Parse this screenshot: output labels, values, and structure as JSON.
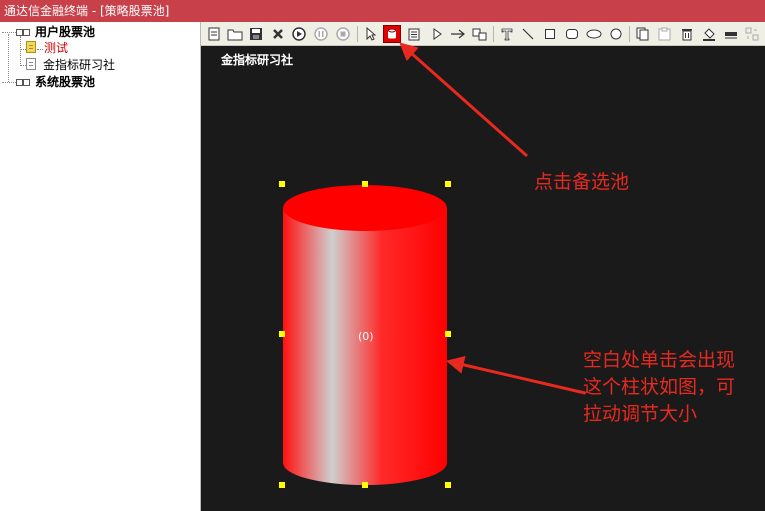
{
  "window": {
    "title": "通达信金融终端 - [策略股票池]"
  },
  "tree": {
    "items": [
      {
        "label": "用户股票池",
        "style": "bold"
      },
      {
        "label": "测试",
        "style": "red"
      },
      {
        "label": "金指标研习社",
        "style": "normal"
      },
      {
        "label": "系统股票池",
        "style": "bold"
      }
    ]
  },
  "toolbar": {
    "buttons": [
      "new-doc-icon",
      "open-folder-icon",
      "save-icon",
      "delete-icon",
      "play-icon",
      "pause-icon",
      "stop-icon",
      "select-arrow-icon",
      "stock-pool-icon",
      "list-icon",
      "triangle-icon",
      "arrow-icon",
      "link-icon",
      "text-icon",
      "line-icon",
      "rectangle-icon",
      "rounded-rect-icon",
      "ellipse-icon",
      "circle-icon",
      "copy-icon",
      "paste-icon",
      "trash-icon",
      "fill-icon",
      "line-width-icon",
      "align-icon"
    ],
    "active": "stock-pool-icon"
  },
  "canvas": {
    "title": "金指标研习社",
    "cylinder_label": "(0)",
    "cylinder_color": "#ff0000",
    "background": "#1a1a1a"
  },
  "annotations": {
    "top": "点击备选池",
    "bottom": [
      "空白处单击会出现",
      "这个柱状如图，可",
      "拉动调节大小"
    ],
    "color": "#e8291f"
  }
}
